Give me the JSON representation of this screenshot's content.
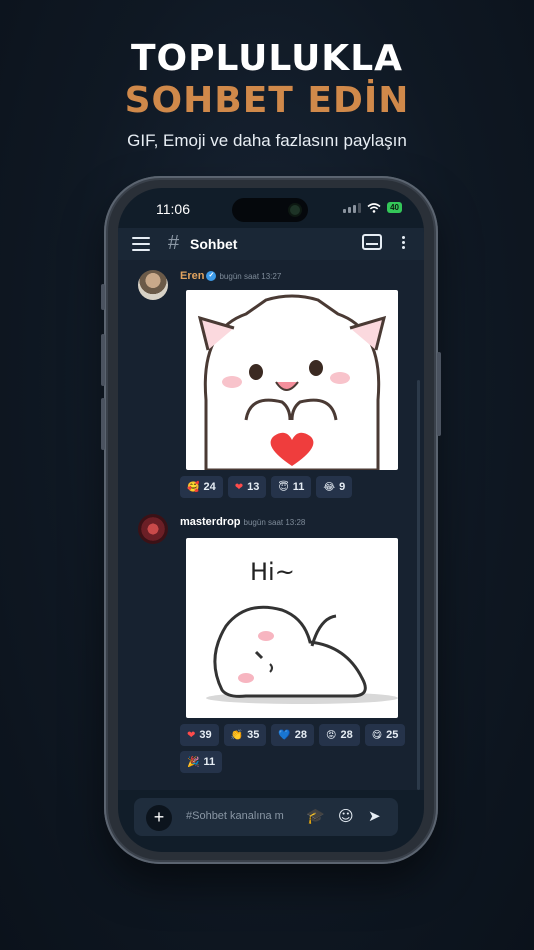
{
  "header": {
    "line1": "TOPLULUKLA",
    "line2": "SOHBET EDİN",
    "subtitle": "GIF, Emoji ve daha fazlasını paylaşın"
  },
  "status_bar": {
    "time": "11:06",
    "battery": "40"
  },
  "app_bar": {
    "hash": "#",
    "channel": "Sohbet"
  },
  "messages": [
    {
      "author": "Eren",
      "author_color": "#e0a35f",
      "verified": true,
      "time": "bugün saat 13:27",
      "reactions": [
        {
          "emoji": "🥰",
          "count": "24"
        },
        {
          "emoji": "❤",
          "count": "13"
        },
        {
          "emoji": "😇",
          "count": "11"
        },
        {
          "emoji": "😂",
          "count": "9"
        }
      ]
    },
    {
      "author": "masterdrop",
      "author_color": "#ffffff",
      "verified": false,
      "time": "bugün saat 13:28",
      "sticker_text": "Hi~",
      "reactions": [
        {
          "emoji": "❤",
          "count": "39"
        },
        {
          "emoji": "👏",
          "count": "35"
        },
        {
          "emoji": "💙",
          "count": "28"
        },
        {
          "emoji": "😡",
          "count": "28"
        },
        {
          "emoji": "😋",
          "count": "25"
        },
        {
          "emoji": "🎉",
          "count": "11"
        }
      ]
    }
  ],
  "composer": {
    "plus": "+",
    "placeholder": "#Sohbet kanalına m"
  }
}
